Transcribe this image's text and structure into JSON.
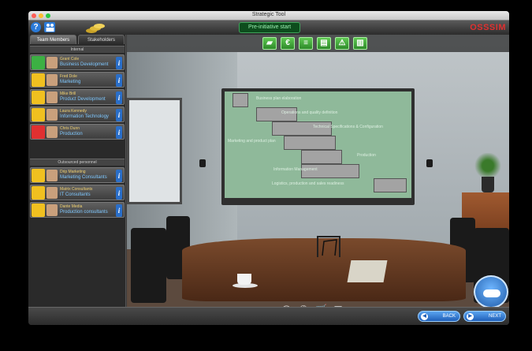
{
  "window": {
    "title": "Strategic Tool"
  },
  "topbar": {
    "status_label": "Pre-initiative start",
    "brand": "OSSSIM",
    "help_label": "?"
  },
  "left_panel": {
    "tabs": [
      {
        "label": "Team Members"
      },
      {
        "label": "Stakeholders"
      }
    ],
    "internal_header": "Internal",
    "internal": [
      {
        "name": "Grant Cole",
        "role": "Business Development",
        "icon_color": "#3cb043"
      },
      {
        "name": "Fred Dole",
        "role": "Marketing",
        "icon_color": "#f0c020"
      },
      {
        "name": "Mike Brill",
        "role": "Product Development",
        "icon_color": "#f0c020"
      },
      {
        "name": "Laura Kennedy",
        "role": "Information Technology",
        "icon_color": "#f0c020"
      },
      {
        "name": "Chris Dunn",
        "role": "Production",
        "icon_color": "#e03030"
      }
    ],
    "external_header": "Outsourced personnel",
    "external": [
      {
        "name": "Drip Marketing",
        "role": "Marketing Consultants",
        "icon_color": "#f0c020"
      },
      {
        "name": "Matrix Consultants",
        "role": "IT Consultants",
        "icon_color": "#f0c020"
      },
      {
        "name": "Dante Media",
        "role": "Production consultants",
        "icon_color": "#f0c020"
      }
    ]
  },
  "toolbar": {
    "tools": [
      {
        "icon": "folder-icon",
        "glyph": "▰"
      },
      {
        "icon": "euro-icon",
        "glyph": "€"
      },
      {
        "icon": "gantt-icon",
        "glyph": "≡"
      },
      {
        "icon": "book-icon",
        "glyph": "▤"
      },
      {
        "icon": "warning-icon",
        "glyph": "⚠"
      },
      {
        "icon": "trash-icon",
        "glyph": "▥"
      }
    ]
  },
  "gantt": {
    "rows": [
      {
        "label": "Business plan elaboration"
      },
      {
        "label": "Operations and quality definition"
      },
      {
        "label": "Technical Specifications & Configuration"
      },
      {
        "label": "Marketing and product plan"
      },
      {
        "label": "Production"
      },
      {
        "label": "Information Management"
      },
      {
        "label": "Logistics, production and sales readiness"
      }
    ]
  },
  "bottom_icons": [
    {
      "icon": "email-icon",
      "glyph": "@"
    },
    {
      "icon": "phone-icon",
      "glyph": "✆"
    },
    {
      "icon": "cart-icon",
      "glyph": "🛒"
    },
    {
      "icon": "document-icon",
      "glyph": "▤"
    }
  ],
  "nav": {
    "back_label": "BACK",
    "next_label": "NEXT"
  }
}
